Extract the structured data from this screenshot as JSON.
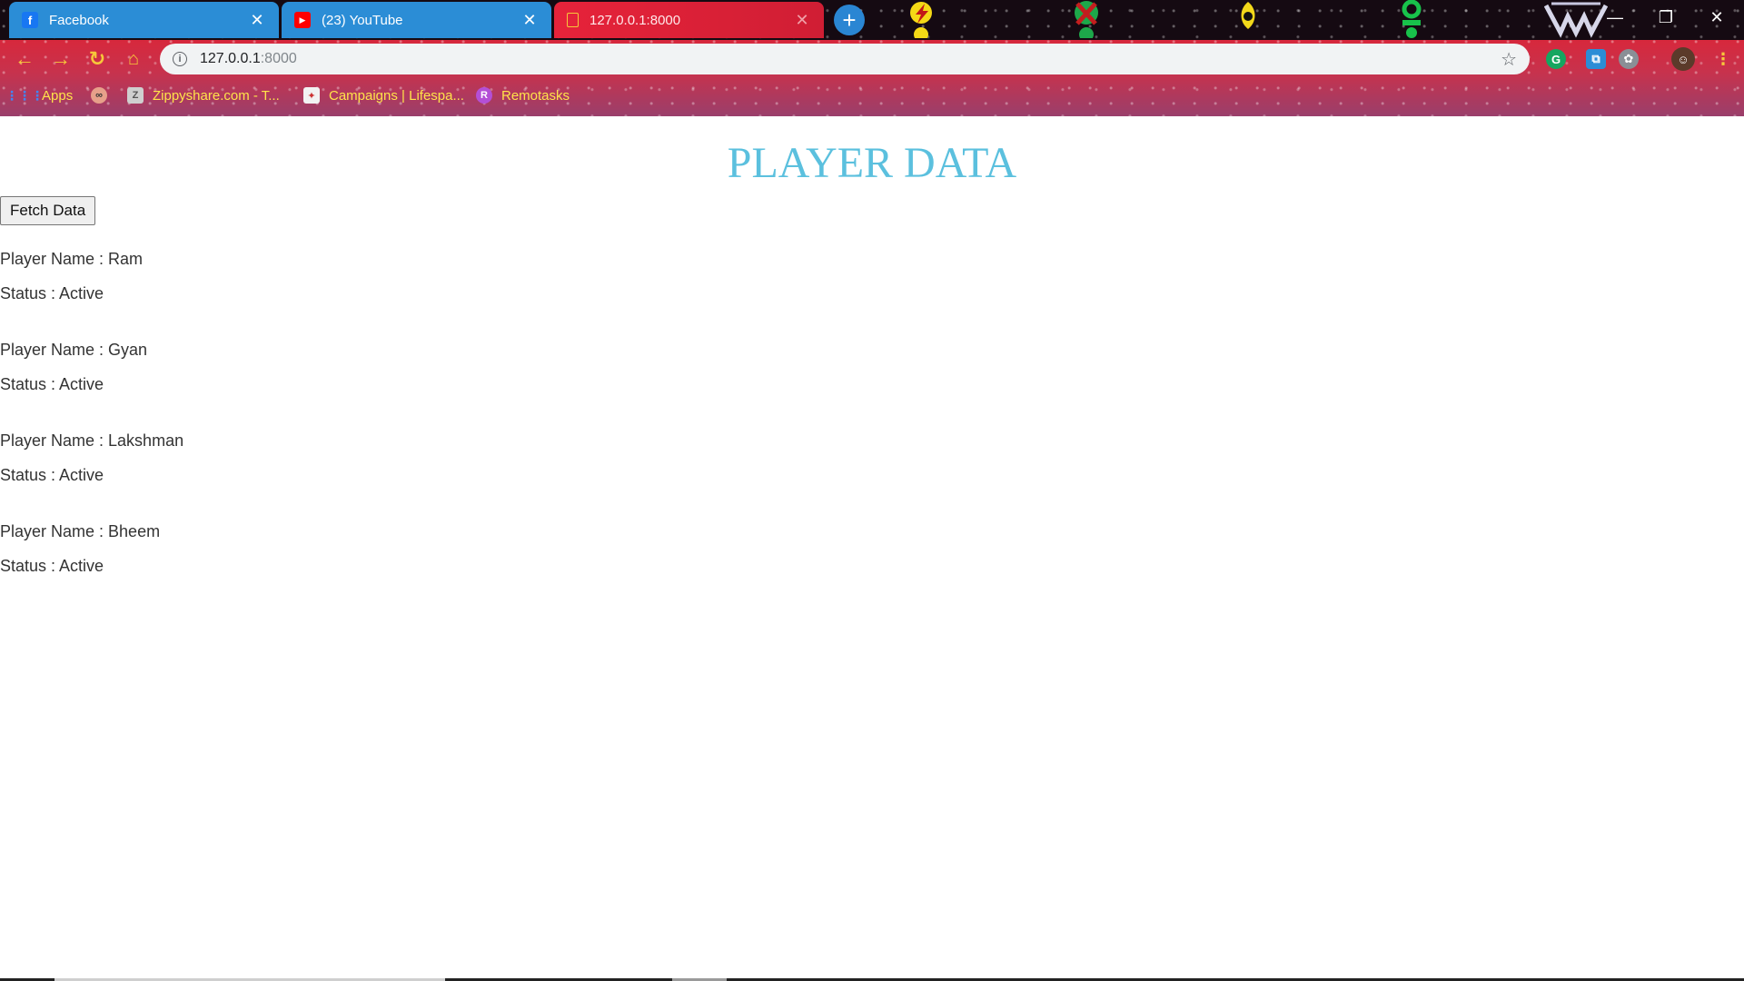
{
  "tabs": [
    {
      "title": "Facebook",
      "favicon": "facebook-icon",
      "active": false
    },
    {
      "title": "(23) YouTube",
      "favicon": "youtube-icon",
      "active": false
    },
    {
      "title": "127.0.0.1:8000",
      "favicon": "page-icon",
      "active": true
    }
  ],
  "toolbar": {
    "url_host": "127.0.0.1",
    "url_port": ":8000"
  },
  "bookmarks": [
    {
      "label": "Apps",
      "icon": "apps-grid-icon"
    },
    {
      "label": "",
      "icon": "glasses-icon"
    },
    {
      "label": "Zippyshare.com - T...",
      "icon": "zippyshare-icon"
    },
    {
      "label": "Campaigns | Lifespa...",
      "icon": "lifespan-icon"
    },
    {
      "label": "Remotasks",
      "icon": "remotasks-icon"
    }
  ],
  "page": {
    "title": "PLAYER DATA",
    "fetch_button": "Fetch Data",
    "players": [
      {
        "name_line": "Player Name : Ram",
        "status_line": "Status : Active"
      },
      {
        "name_line": "Player Name : Gyan",
        "status_line": "Status : Active"
      },
      {
        "name_line": "Player Name : Lakshman",
        "status_line": "Status : Active"
      },
      {
        "name_line": "Player Name : Bheem",
        "status_line": "Status : Active"
      }
    ]
  },
  "colors": {
    "title": "#5bc0de",
    "tab_inactive": "#2b8dd6",
    "tab_active": "#e6233a",
    "bookmark_text": "#ffe34a"
  }
}
